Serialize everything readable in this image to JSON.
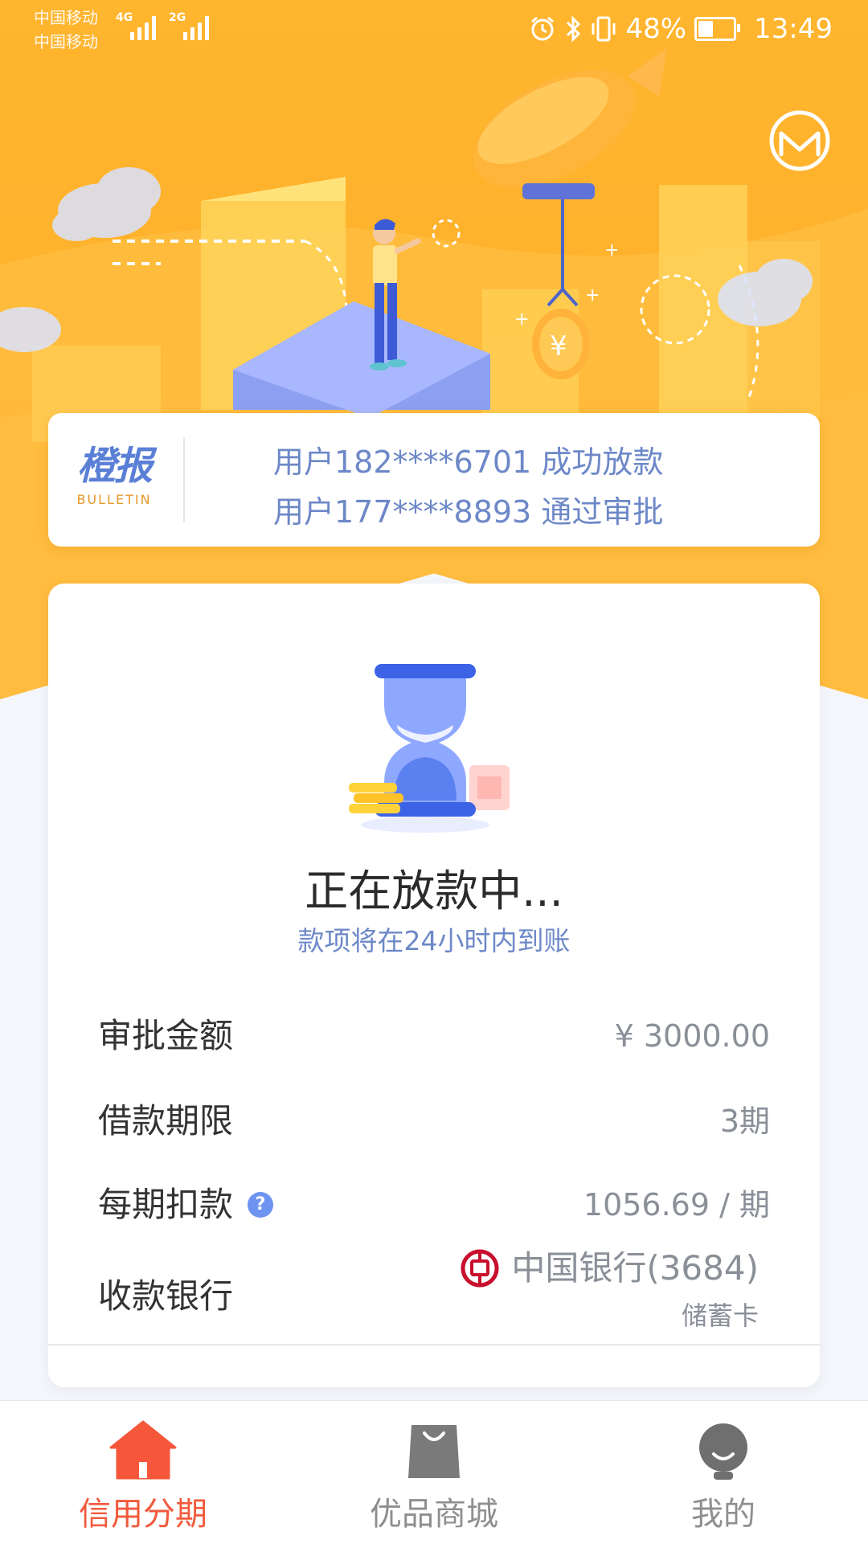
{
  "status_bar": {
    "carrier_1": "中国移动",
    "carrier_2": "中国移动",
    "net_1": "4G",
    "net_2": "2G",
    "battery": "48%",
    "battery_level": 0.48,
    "time": "13:49",
    "icons": [
      "alarm-icon",
      "bluetooth-icon",
      "vibrate-icon",
      "battery-icon"
    ]
  },
  "header": {
    "message_icon": "message-icon"
  },
  "bulletin": {
    "logo_cn": "橙报",
    "logo_en": "BULLETIN",
    "lines": [
      "用户182****6701 成功放款",
      "用户177****8893 通过审批"
    ]
  },
  "status": {
    "title": "正在放款中...",
    "subtitle": "款项将在24小时内到账"
  },
  "details": {
    "amount": {
      "label": "审批金额",
      "value": "¥ 3000.00"
    },
    "term": {
      "label": "借款期限",
      "value": "3期"
    },
    "installment": {
      "label": "每期扣款",
      "value": "1056.69 / 期",
      "help": "?"
    },
    "bank": {
      "label": "收款银行",
      "value": "中国银行(3684)",
      "card_type": "储蓄卡"
    }
  },
  "tabs": [
    {
      "label": "信用分期",
      "icon": "home-icon",
      "active": true
    },
    {
      "label": "优品商城",
      "icon": "shopping-bag-icon",
      "active": false
    },
    {
      "label": "我的",
      "icon": "profile-icon",
      "active": false
    }
  ],
  "colors": {
    "brand_orange": "#ffb12c",
    "accent_blue": "#6d88c8",
    "active_tab": "#f15a3d",
    "bank_red": "#c8102e"
  }
}
